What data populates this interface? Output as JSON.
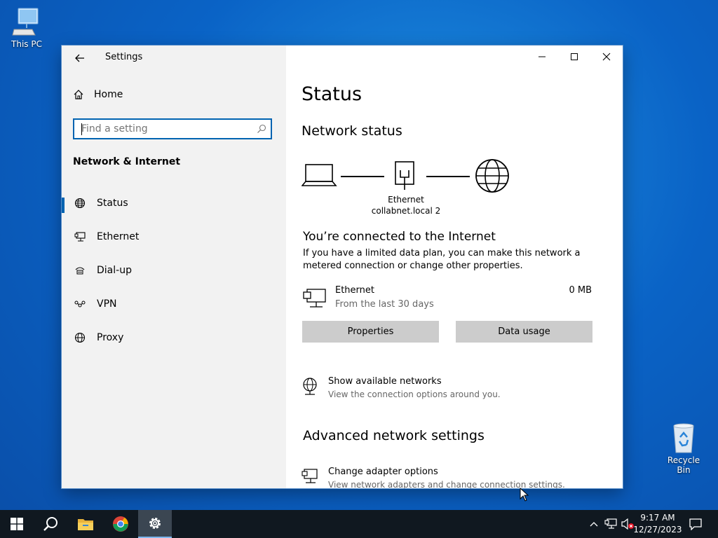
{
  "desktop": {
    "icons": [
      {
        "label": "This PC"
      },
      {
        "label": "Recycle Bin"
      }
    ]
  },
  "window": {
    "app_title": "Settings",
    "controls": [
      "minimize",
      "maximize",
      "close"
    ]
  },
  "sidebar": {
    "home_label": "Home",
    "search_placeholder": "Find a setting",
    "section_title": "Network & Internet",
    "items": [
      {
        "label": "Status",
        "icon": "globe-icon",
        "active": true
      },
      {
        "label": "Ethernet",
        "icon": "ethernet-icon"
      },
      {
        "label": "Dial-up",
        "icon": "dialup-icon"
      },
      {
        "label": "VPN",
        "icon": "vpn-icon"
      },
      {
        "label": "Proxy",
        "icon": "globe-icon"
      }
    ]
  },
  "main": {
    "page_title": "Status",
    "network_status_heading": "Network status",
    "diagram": {
      "adapter_label": "Ethernet",
      "network_name": "collabnet.local 2"
    },
    "connected_text": "You’re connected to the Internet",
    "description": "If you have a limited data plan, you can make this network a metered connection or change other properties.",
    "connection": {
      "name": "Ethernet",
      "subtitle": "From the last 30 days",
      "usage": "0 MB"
    },
    "buttons": {
      "properties": "Properties",
      "data_usage": "Data usage"
    },
    "show_networks": {
      "title": "Show available networks",
      "subtitle": "View the connection options around you."
    },
    "advanced_heading": "Advanced network settings",
    "change_adapter": {
      "title": "Change adapter options",
      "subtitle": "View network adapters and change connection settings."
    }
  },
  "taskbar": {
    "time": "9:17 AM",
    "date": "12/27/2023"
  },
  "colors": {
    "accent": "#0063b1",
    "taskbar": "#101820",
    "button_gray": "#cccccc"
  }
}
